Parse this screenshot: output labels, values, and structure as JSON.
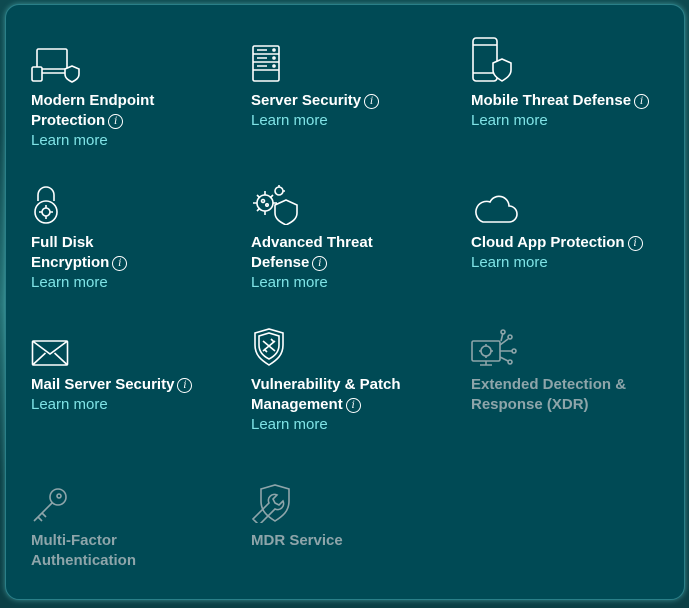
{
  "tiles": [
    {
      "title_line1": "Modern Endpoint",
      "title_line2": "Protection",
      "learn": "Learn more",
      "icon": "laptop-phone-shield-icon"
    },
    {
      "title_line1": "Server Security",
      "learn": "Learn more",
      "icon": "server-icon"
    },
    {
      "title_line1": "Mobile Threat Defense",
      "learn": "Learn more",
      "icon": "phone-shield-icon"
    },
    {
      "title_line1": "Full Disk",
      "title_line2": "Encryption",
      "learn": "Learn more",
      "icon": "lock-icon"
    },
    {
      "title_line1": "Advanced Threat",
      "title_line2": "Defense",
      "learn": "Learn more",
      "icon": "virus-shield-icon"
    },
    {
      "title_line1": "Cloud App Protection",
      "learn": "Learn more",
      "icon": "cloud-icon"
    },
    {
      "title_line1": "Mail Server Security",
      "learn": "Learn more",
      "icon": "envelope-icon"
    },
    {
      "title_line1": "Vulnerability & Patch",
      "title_line2": "Management",
      "learn": "Learn more",
      "icon": "patch-shield-icon"
    },
    {
      "title_line1": "Extended Detection &",
      "title_line2": "Response (XDR)",
      "icon": "xdr-monitor-icon"
    },
    {
      "title_line1": "Multi-Factor",
      "title_line2": "Authentication",
      "icon": "key-icon"
    },
    {
      "title_line1": "MDR Service",
      "icon": "wrench-shield-icon"
    }
  ],
  "info_glyph": "i"
}
